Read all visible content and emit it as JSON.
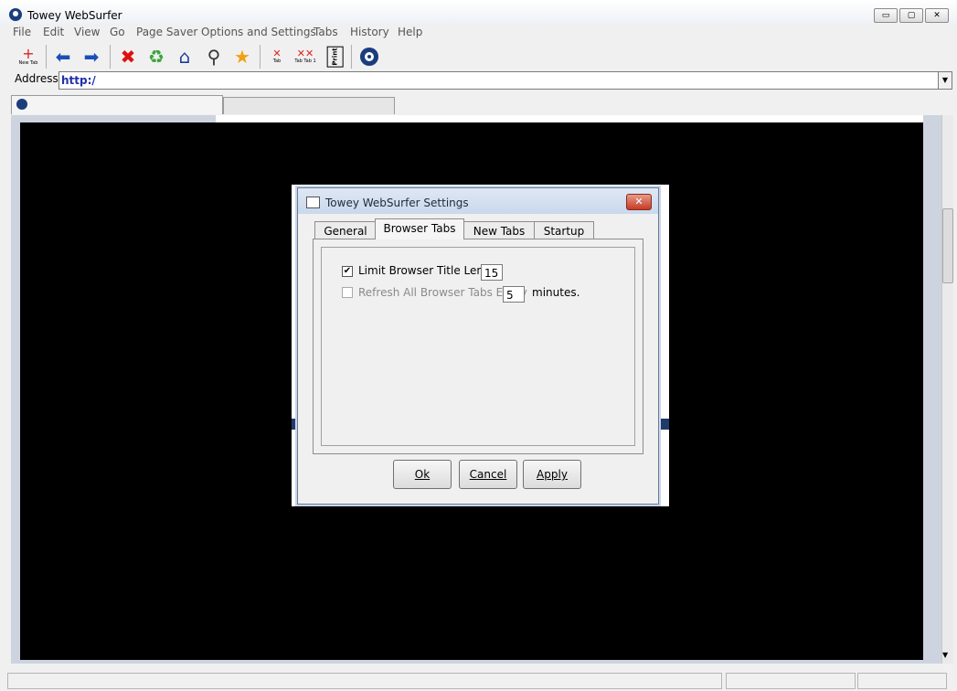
{
  "window": {
    "title": "Towey WebSurfer",
    "caption_buttons": [
      "▭",
      "▢",
      "✕"
    ]
  },
  "menu": [
    "File",
    "Edit",
    "View",
    "Go",
    "Page Saver",
    "Options and Settings",
    "Tabs",
    "History",
    "Help"
  ],
  "toolbar": {
    "new_tab_label": "New Tab",
    "close_tab_label": "Tab",
    "close_tabs_label": "Tab Tab 1",
    "print_label": "Print"
  },
  "address": {
    "label": "Address:",
    "value": "http:/"
  },
  "dialog": {
    "title": "Towey WebSurfer Settings",
    "close_glyph": "✕",
    "tabs": [
      "General",
      "Browser Tabs",
      "New Tabs",
      "Startup"
    ],
    "active_tab": "Browser Tabs",
    "limit_title": {
      "label": "Limit Browser Title Length",
      "checked": true,
      "value": "15"
    },
    "refresh": {
      "label": "Refresh All Browser Tabs Every",
      "checked": false,
      "value": "5",
      "unit": "minutes."
    },
    "buttons": [
      "Ok",
      "Cancel",
      "Apply"
    ]
  },
  "colors": {
    "address_text": "#1f2fae",
    "close_button": "#c43b26"
  }
}
